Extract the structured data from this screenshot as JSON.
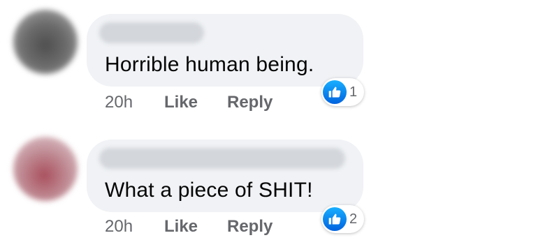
{
  "comments": [
    {
      "text": "Horrible human being.",
      "time": "20h",
      "like_label": "Like",
      "reply_label": "Reply",
      "reaction_icon": "thumbs-up-icon",
      "reaction_count": "1"
    },
    {
      "text": "What a piece of SHIT!",
      "time": "20h",
      "like_label": "Like",
      "reply_label": "Reply",
      "reaction_icon": "thumbs-up-icon",
      "reaction_count": "2"
    }
  ],
  "colors": {
    "bubble": "#f0f2f5",
    "text": "#050505",
    "meta": "#65676b",
    "like_blue": "#0866ff"
  }
}
